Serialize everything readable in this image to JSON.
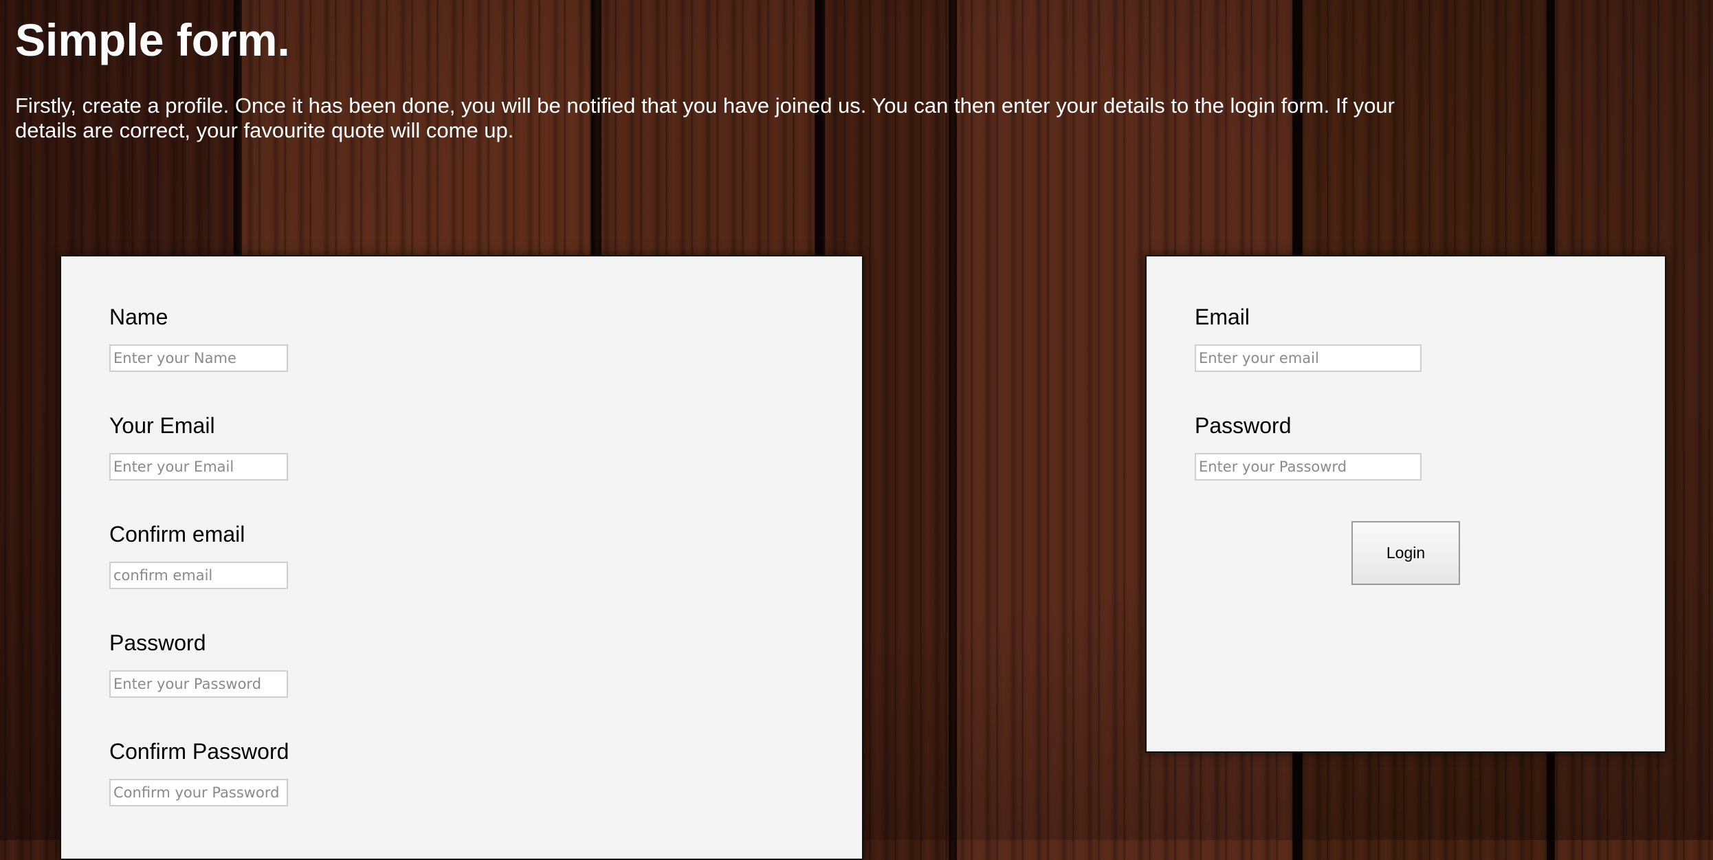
{
  "page": {
    "title": "Simple form.",
    "intro": "Firstly, create a profile. Once it has been done, you will be notified that you have joined us. You can then enter your details to the login form. If your details are correct, your favourite quote will come up."
  },
  "signup": {
    "fields": [
      {
        "label": "Name",
        "placeholder": "Enter your Name",
        "value": ""
      },
      {
        "label": "Your Email",
        "placeholder": "Enter your Email",
        "value": ""
      },
      {
        "label": "Confirm email",
        "placeholder": "confirm email",
        "value": ""
      },
      {
        "label": "Password",
        "placeholder": "Enter your Password",
        "value": ""
      },
      {
        "label": "Confirm Password",
        "placeholder": "Confirm your Password",
        "value": ""
      }
    ]
  },
  "login": {
    "fields": [
      {
        "label": "Email",
        "placeholder": "Enter your email",
        "value": ""
      },
      {
        "label": "Password",
        "placeholder": "Enter your Passowrd",
        "value": ""
      }
    ],
    "button_label": "Login"
  },
  "colors": {
    "panel_background": "#f4f4f4",
    "heading_text": "#ffffff",
    "label_text": "#000000",
    "background_wood": "#4a2517"
  }
}
